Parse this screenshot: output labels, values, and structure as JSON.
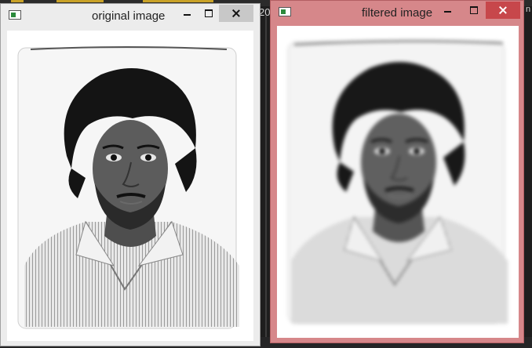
{
  "background": {
    "fragment_text": "20",
    "right_text": "n",
    "colors": {
      "desktop": "#1e1e1e",
      "taskbar": "#252526",
      "accent": "#3e6ea6"
    }
  },
  "windows": [
    {
      "title": "original image",
      "icon": "app-window-icon",
      "controls": [
        "minimize-icon",
        "maximize-icon",
        "close-icon"
      ],
      "state": "inactive",
      "frame_color": "#ececec",
      "content": {
        "kind": "grayscale portrait photo",
        "filter": "none"
      }
    },
    {
      "title": "filtered image",
      "icon": "app-window-icon",
      "controls": [
        "minimize-icon",
        "maximize-icon",
        "close-icon"
      ],
      "state": "active",
      "frame_color": "#d6878a",
      "content": {
        "kind": "grayscale portrait photo",
        "filter": "blur"
      }
    }
  ]
}
